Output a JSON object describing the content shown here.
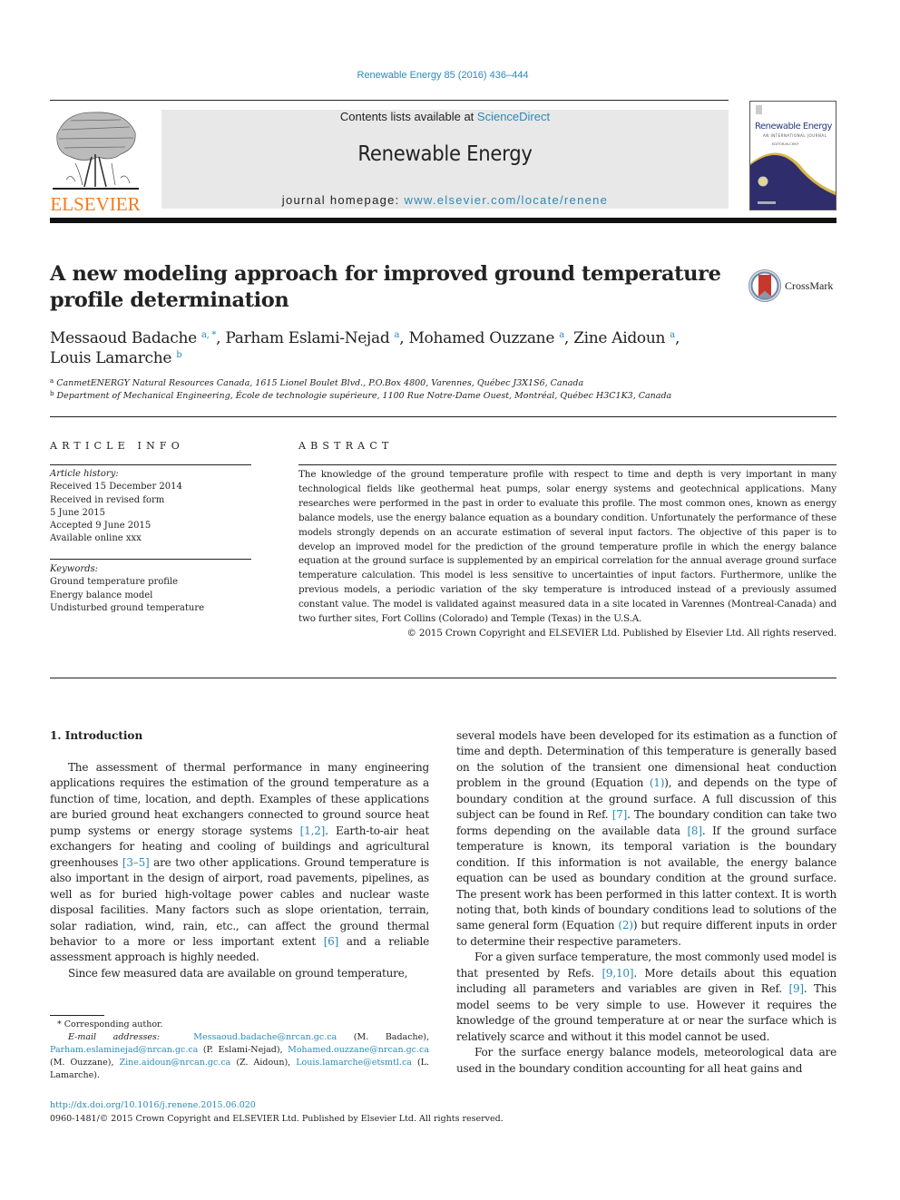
{
  "header": {
    "journal_reference": "Renewable Energy 85 (2016) 436–444",
    "publisher_logo_text": "ELSEVIER",
    "contents_prefix": "Contents lists available at ",
    "contents_link": "ScienceDirect",
    "journal_title": "Renewable Energy",
    "homepage_prefix": "journal homepage: ",
    "homepage_link": "www.elsevier.com/locate/renene",
    "cover": {
      "title": "Renewable Energy",
      "subtitle": "AN INTERNATIONAL JOURNAL",
      "editor_line": "EDITOR-IN-CHIEF"
    }
  },
  "article": {
    "title": "A new modeling approach for improved ground temperature profile determination",
    "crossmark_label": "CrossMark",
    "authors": [
      {
        "name": "Messaoud Badache",
        "sup": "a, *",
        "sep": ", "
      },
      {
        "name": "Parham Eslami-Nejad",
        "sup": "a",
        "sep": ", "
      },
      {
        "name": "Mohamed Ouzzane",
        "sup": "a",
        "sep": ", "
      },
      {
        "name": "Zine Aidoun",
        "sup": "a",
        "sep": ","
      },
      {
        "name": "Louis Lamarche",
        "sup": "b",
        "sep": ""
      }
    ],
    "affiliations": [
      {
        "key": "a",
        "text": "CanmetENERGY Natural Resources Canada, 1615 Lionel Boulet Blvd., P.O.Box 4800, Varennes, Québec J3X1S6, Canada"
      },
      {
        "key": "b",
        "text": "Department of Mechanical Engineering, École de technologie supérieure, 1100 Rue Notre-Dame Ouest, Montréal, Québec H3C1K3, Canada"
      }
    ]
  },
  "article_info": {
    "heading": "ARTICLE INFO",
    "history_label": "Article history:",
    "history": [
      "Received 15 December 2014",
      "Received in revised form",
      "5 June 2015",
      "Accepted 9 June 2015",
      "Available online xxx"
    ],
    "keywords_label": "Keywords:",
    "keywords": [
      "Ground temperature profile",
      "Energy balance model",
      "Undisturbed ground temperature"
    ]
  },
  "abstract": {
    "heading": "ABSTRACT",
    "text": "The knowledge of the ground temperature profile with respect to time and depth is very important in many technological fields like geothermal heat pumps, solar energy systems and geotechnical applications. Many researches were performed in the past in order to evaluate this profile. The most common ones, known as energy balance models, use the energy balance equation as a boundary condition. Unfortunately the performance of these models strongly depends on an accurate estimation of several input factors. The objective of this paper is to develop an improved model for the prediction of the ground temperature profile in which the energy balance equation at the ground surface is supplemented by an empirical correlation for the annual average ground surface temperature calculation. This model is less sensitive to uncertainties of input factors. Furthermore, unlike the previous models, a periodic variation of the sky temperature is introduced instead of a previously assumed constant value. The model is validated against measured data in a site located in Varennes (Montreal-Canada) and two further sites, Fort Collins (Colorado) and Temple (Texas) in the U.S.A.",
    "copyright": "© 2015 Crown Copyright and ELSEVIER Ltd. Published by Elsevier Ltd. All rights reserved."
  },
  "body": {
    "section_heading": "1.  Introduction",
    "left_col": {
      "p1": [
        {
          "t": "The assessment of thermal performance in many engineering applications requires the estimation of the ground temperature as a function of time, location, and depth. Examples of these applications are buried ground heat exchangers connected to ground source heat pump systems or energy storage systems "
        },
        {
          "link": "[1,2]"
        },
        {
          "t": ". Earth-to-air heat exchangers for heating and cooling of buildings and agricultural greenhouses "
        },
        {
          "link": "[3–5]"
        },
        {
          "t": " are two other applications. Ground temperature is also important in the design of airport, road pavements, pipelines, as well as for buried high-voltage power cables and nuclear waste disposal facilities. Many factors such as slope orientation, terrain, solar radiation, wind, rain, etc., can affect the ground thermal behavior to a more or less important extent "
        },
        {
          "link": "[6]"
        },
        {
          "t": " and a reliable assessment approach is highly needed."
        }
      ],
      "p2": [
        {
          "t": "Since few measured data are available on ground temperature,"
        }
      ]
    },
    "right_col": {
      "p1": [
        {
          "t": "several models have been developed for its estimation as a function of time and depth. Determination of this temperature is generally based on the solution of the transient one dimensional heat conduction problem in the ground (Equation "
        },
        {
          "link": "(1)"
        },
        {
          "t": "), and depends on the type of boundary condition at the ground surface. A full discussion of this subject can be found in Ref. "
        },
        {
          "link": "[7]"
        },
        {
          "t": ". The boundary condition can take two forms depending on the available data "
        },
        {
          "link": "[8]"
        },
        {
          "t": ". If the ground surface temperature is known, its temporal variation is the boundary condition. If this information is not available, the energy balance equation can be used as boundary condition at the ground surface. The present work has been performed in this latter context. It is worth noting that, both kinds of boundary conditions lead to solutions of the same general form (Equation "
        },
        {
          "link": "(2)"
        },
        {
          "t": ") but require different inputs in order to determine their respective parameters."
        }
      ],
      "p2": [
        {
          "t": "For a given surface temperature, the most commonly used model is that presented by Refs. "
        },
        {
          "link": "[9,10]"
        },
        {
          "t": ". More details about this equation including all parameters and variables are given in Ref. "
        },
        {
          "link": "[9]"
        },
        {
          "t": ". This model seems to be very simple to use. However it requires the knowledge of the ground temperature at or near the surface which is relatively scarce and without it this model cannot be used."
        }
      ],
      "p3": [
        {
          "t": "For the surface energy balance models, meteorological data are used in the boundary condition accounting for all heat gains and"
        }
      ]
    }
  },
  "footnotes": {
    "corresponding": "* Corresponding author.",
    "email_label": "E-mail addresses:",
    "emails": [
      {
        "email": "Messaoud.badache@nrcan.gc.ca",
        "who": " (M. Badache), "
      },
      {
        "email": "Parham.eslaminejad@nrcan.gc.ca",
        "who": " (P. Eslami-Nejad), "
      },
      {
        "email": "Mohamed.ouzzane@nrcan.gc.ca",
        "who": " (M. Ouzzane), "
      },
      {
        "email": "Zine.aidoun@nrcan.gc.ca",
        "who": " (Z. Aidoun), "
      },
      {
        "email": "Louis.lamarche@etsmtl.ca",
        "who": " (L. Lamarche)."
      }
    ]
  },
  "footer": {
    "doi": "http://dx.doi.org/10.1016/j.renene.2015.06.020",
    "issn_copyright": "0960-1481/© 2015 Crown Copyright and ELSEVIER Ltd. Published by Elsevier Ltd. All rights reserved."
  },
  "colors": {
    "link": "#2a8ab8",
    "elsevier_orange": "#f07d1e",
    "masthead_bg": "#e8e8e8",
    "cover_navy": "#2f2d6b",
    "cover_gold": "#d9b54a",
    "crossmark_red": "#c8372d"
  }
}
